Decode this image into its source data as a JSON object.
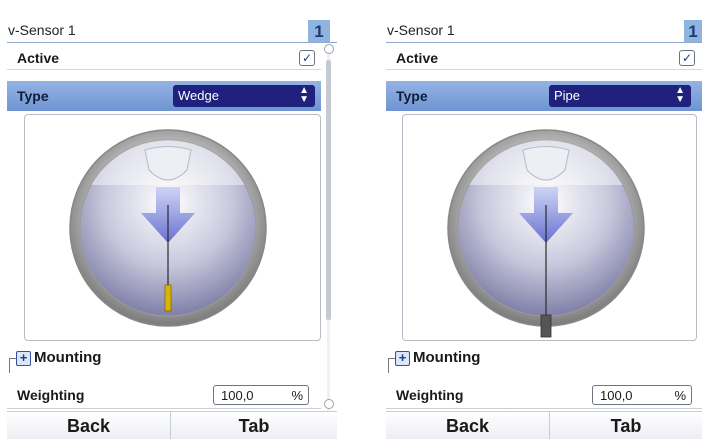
{
  "left_panel": {
    "title": "v-Sensor 1",
    "number": "1",
    "active_label": "Active",
    "active_checked": true,
    "type_label": "Type",
    "type_value": "Wedge",
    "section_label": "Mounting",
    "weighting_label": "Weighting",
    "weighting_value": "100,0",
    "weighting_unit": "%",
    "back_label": "Back",
    "tab_label": "Tab"
  },
  "right_panel": {
    "title": "v-Sensor 1",
    "number": "1",
    "active_label": "Active",
    "active_checked": true,
    "type_label": "Type",
    "type_value": "Pipe",
    "section_label": "Mounting",
    "weighting_label": "Weighting",
    "weighting_value": "100,0",
    "weighting_unit": "%",
    "back_label": "Back",
    "tab_label": "Tab"
  },
  "icons": {
    "checkbox": "checkmark-icon",
    "select": "up-down-arrows-icon",
    "expand": "plus-icon"
  },
  "colors": {
    "type_row": "#7fa3dc",
    "select_bg": "#20207d",
    "number_badge": "#8fb4e0",
    "sensor_wedge_tip": "#d9b400",
    "sensor_pipe_tip": "#555555"
  }
}
